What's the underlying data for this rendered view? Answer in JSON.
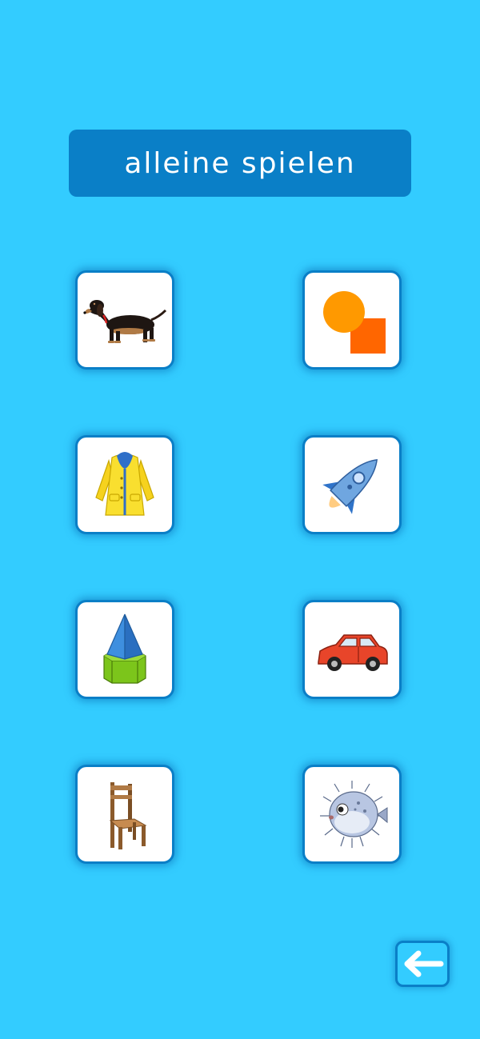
{
  "header": {
    "title": "alleine spielen"
  },
  "cards": [
    {
      "icon": "dog-icon"
    },
    {
      "icon": "shapes-icon"
    },
    {
      "icon": "raincoat-icon"
    },
    {
      "icon": "rocket-icon"
    },
    {
      "icon": "pyramid-prism-icon"
    },
    {
      "icon": "car-icon"
    },
    {
      "icon": "chair-icon"
    },
    {
      "icon": "pufferfish-icon"
    }
  ],
  "navigation": {
    "back_icon": "arrow-left-icon"
  },
  "colors": {
    "background": "#33ccff",
    "title_bar": "#0a7fc7",
    "card_border": "#0a7fc7",
    "card_fill": "#ffffff"
  }
}
